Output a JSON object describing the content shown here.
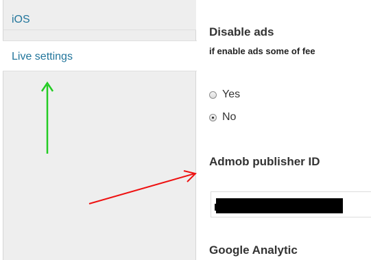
{
  "sidebar": {
    "items": [
      {
        "label": "iOS"
      },
      {
        "label": "Live settings"
      }
    ]
  },
  "main": {
    "disable_ads": {
      "title": "Disable ads",
      "subtitle": "if enable ads some of fee",
      "options": [
        {
          "label": "Yes",
          "checked": false
        },
        {
          "label": "No",
          "checked": true
        }
      ]
    },
    "admob": {
      "title": "Admob publisher ID",
      "value": "",
      "redacted": true
    },
    "google_analytics": {
      "title": "Google Analytic"
    }
  },
  "annotations": {
    "green_arrow_color": "#22cc22",
    "red_arrow_color": "#ee1111"
  },
  "colors": {
    "link": "#21759b",
    "sidebar_bg": "#eeeeee"
  }
}
